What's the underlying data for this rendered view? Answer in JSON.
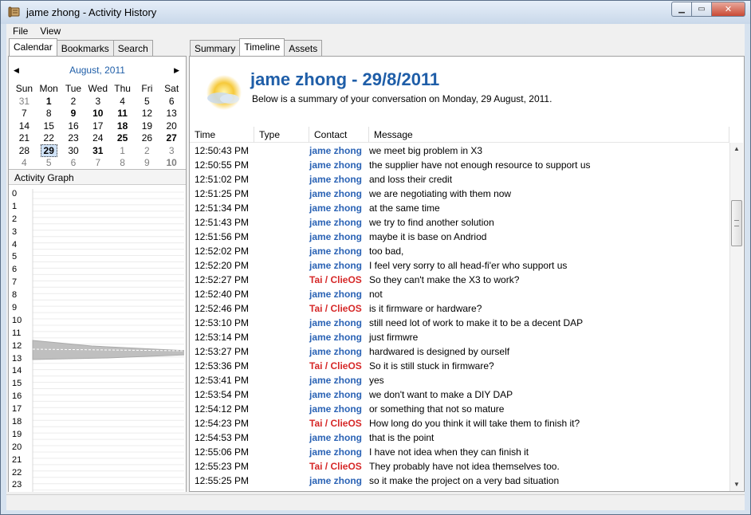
{
  "window": {
    "title": "jame zhong - Activity History"
  },
  "menu": {
    "file": "File",
    "view": "View"
  },
  "left_tabs": [
    "Calendar",
    "Bookmarks",
    "Search"
  ],
  "right_tabs": [
    "Summary",
    "Timeline",
    "Assets"
  ],
  "calendar": {
    "month_title": "August, 2011",
    "day_names": [
      "Sun",
      "Mon",
      "Tue",
      "Wed",
      "Thu",
      "Fri",
      "Sat"
    ],
    "weeks": [
      [
        [
          "31",
          "other"
        ],
        [
          "1",
          "bold"
        ],
        [
          "2",
          ""
        ],
        [
          "3",
          ""
        ],
        [
          "4",
          ""
        ],
        [
          "5",
          ""
        ],
        [
          "6",
          ""
        ]
      ],
      [
        [
          "7",
          ""
        ],
        [
          "8",
          ""
        ],
        [
          "9",
          "bold"
        ],
        [
          "10",
          "bold"
        ],
        [
          "11",
          "bold"
        ],
        [
          "12",
          ""
        ],
        [
          "13",
          ""
        ]
      ],
      [
        [
          "14",
          ""
        ],
        [
          "15",
          ""
        ],
        [
          "16",
          ""
        ],
        [
          "17",
          ""
        ],
        [
          "18",
          "bold"
        ],
        [
          "19",
          ""
        ],
        [
          "20",
          ""
        ]
      ],
      [
        [
          "21",
          ""
        ],
        [
          "22",
          ""
        ],
        [
          "23",
          ""
        ],
        [
          "24",
          ""
        ],
        [
          "25",
          "bold"
        ],
        [
          "26",
          ""
        ],
        [
          "27",
          "bold"
        ]
      ],
      [
        [
          "28",
          ""
        ],
        [
          "29",
          "today bold"
        ],
        [
          "30",
          ""
        ],
        [
          "31",
          "bold"
        ],
        [
          "1",
          "other"
        ],
        [
          "2",
          "other"
        ],
        [
          "3",
          "other"
        ]
      ],
      [
        [
          "4",
          "other"
        ],
        [
          "5",
          "other"
        ],
        [
          "6",
          "other"
        ],
        [
          "7",
          "other"
        ],
        [
          "8",
          "other"
        ],
        [
          "9",
          "other"
        ],
        [
          "10",
          "other bold"
        ]
      ]
    ]
  },
  "activity_graph": {
    "label": "Activity Graph",
    "hours": [
      "0",
      "1",
      "2",
      "3",
      "4",
      "5",
      "6",
      "7",
      "8",
      "9",
      "10",
      "11",
      "12",
      "13",
      "14",
      "15",
      "16",
      "17",
      "18",
      "19",
      "20",
      "21",
      "22",
      "23"
    ]
  },
  "header": {
    "title": "jame zhong - 29/8/2011",
    "subtitle": "Below is a summary of your conversation on Monday, 29 August, 2011."
  },
  "columns": {
    "time": "Time",
    "type": "Type",
    "contact": "Contact",
    "message": "Message"
  },
  "messages": [
    {
      "time": "12:50:43 PM",
      "contact": "jame zhong",
      "who": "me",
      "text": "we meet big problem in X3"
    },
    {
      "time": "12:50:55 PM",
      "contact": "jame zhong",
      "who": "me",
      "text": "the supplier have not enough resource to support us"
    },
    {
      "time": "12:51:02 PM",
      "contact": "jame zhong",
      "who": "me",
      "text": "and loss their credit"
    },
    {
      "time": "12:51:25 PM",
      "contact": "jame zhong",
      "who": "me",
      "text": "we are negotiating with them now"
    },
    {
      "time": "12:51:34 PM",
      "contact": "jame zhong",
      "who": "me",
      "text": "at the same time"
    },
    {
      "time": "12:51:43 PM",
      "contact": "jame zhong",
      "who": "me",
      "text": "we try to find another solution"
    },
    {
      "time": "12:51:56 PM",
      "contact": "jame zhong",
      "who": "me",
      "text": "maybe it is base on Andriod"
    },
    {
      "time": "12:52:02 PM",
      "contact": "jame zhong",
      "who": "me",
      "text": "too bad,"
    },
    {
      "time": "12:52:20 PM",
      "contact": "jame zhong",
      "who": "me",
      "text": "I feel very sorry to all head-fi'er who support us"
    },
    {
      "time": "12:52:27 PM",
      "contact": "Tai / ClieOS",
      "who": "other",
      "text": "So they can't make the X3 to work?"
    },
    {
      "time": "12:52:40 PM",
      "contact": "jame zhong",
      "who": "me",
      "text": "not"
    },
    {
      "time": "12:52:46 PM",
      "contact": "Tai / ClieOS",
      "who": "other",
      "text": "is it firmware or hardware?"
    },
    {
      "time": "12:53:10 PM",
      "contact": "jame zhong",
      "who": "me",
      "text": "still need lot of work to make it to be a decent DAP"
    },
    {
      "time": "12:53:14 PM",
      "contact": "jame zhong",
      "who": "me",
      "text": "just firmwre"
    },
    {
      "time": "12:53:27 PM",
      "contact": "jame zhong",
      "who": "me",
      "text": "hardwared is designed by ourself"
    },
    {
      "time": "12:53:36 PM",
      "contact": "Tai / ClieOS",
      "who": "other",
      "text": "So it is still stuck in firmware?"
    },
    {
      "time": "12:53:41 PM",
      "contact": "jame zhong",
      "who": "me",
      "text": "yes"
    },
    {
      "time": "12:53:54 PM",
      "contact": "jame zhong",
      "who": "me",
      "text": "we don't want to make a DIY DAP"
    },
    {
      "time": "12:54:12 PM",
      "contact": "jame zhong",
      "who": "me",
      "text": "or something that not so mature"
    },
    {
      "time": "12:54:23 PM",
      "contact": "Tai / ClieOS",
      "who": "other",
      "text": "How long do you think it will take them to finish it?"
    },
    {
      "time": "12:54:53 PM",
      "contact": "jame zhong",
      "who": "me",
      "text": "that is the point"
    },
    {
      "time": "12:55:06 PM",
      "contact": "jame zhong",
      "who": "me",
      "text": "I have not idea when they can finish it"
    },
    {
      "time": "12:55:23 PM",
      "contact": "Tai / ClieOS",
      "who": "other",
      "text": "They probably have not idea themselves too."
    },
    {
      "time": "12:55:25 PM",
      "contact": "jame zhong",
      "who": "me",
      "text": "so it make the project on a very bad situation"
    }
  ],
  "colors": {
    "accent_blue": "#1f5ea8",
    "me": "#2b63b5",
    "other": "#d62828"
  },
  "icons": {
    "app": "scroll-icon",
    "header": "sun-icon"
  }
}
